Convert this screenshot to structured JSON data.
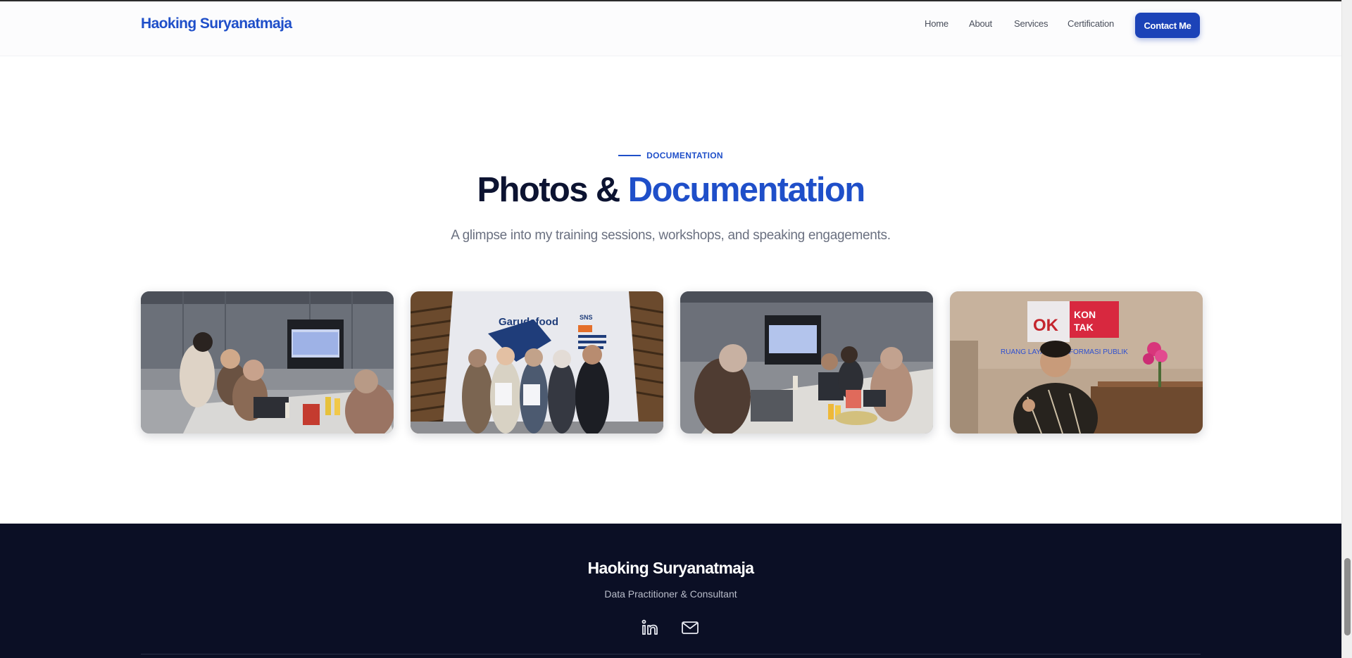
{
  "nav": {
    "brand": "Haoking Suryanatmaja",
    "links": [
      "Home",
      "About",
      "Services",
      "Certification"
    ],
    "cta": "Contact Me"
  },
  "section": {
    "eyebrow": "DOCUMENTATION",
    "title_main": "Photos & ",
    "title_accent": "Documentation",
    "subtitle": "A glimpse into my training sessions, workshops, and speaking engagements."
  },
  "gallery": {
    "photos": [
      {
        "subject": "training-session-room"
      },
      {
        "subject": "garudafood-group-photo",
        "banner_text": "Garudafood",
        "sign_text": "SNS"
      },
      {
        "subject": "workshop-laptops"
      },
      {
        "subject": "kontak-ok-portrait",
        "logo_text_1": "OK",
        "logo_text_2": "KON",
        "logo_text_3": "TAK",
        "wall_text": "RUANG LAYANAN INFORMASI PUBLIK"
      }
    ]
  },
  "footer": {
    "name": "Haoking Suryanatmaja",
    "tagline": "Data Practitioner & Consultant",
    "socials": [
      {
        "icon": "linkedin-icon"
      },
      {
        "icon": "mail-icon"
      }
    ]
  },
  "colors": {
    "accent": "#1f4fc9",
    "heading": "#0c1331",
    "footer_bg": "#0b0f25",
    "cta_bg": "#1c43b8"
  }
}
